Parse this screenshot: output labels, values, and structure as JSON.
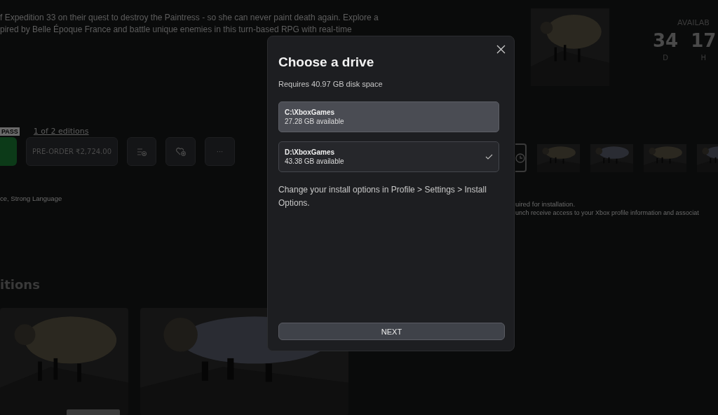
{
  "background": {
    "description": [
      "f Expedition 33 on their quest to destroy the Paintress - so she can never paint death again. Explore a",
      "pired by Belle Époque France and battle unique enemies in this turn-based RPG with real-time"
    ],
    "pass_badge": "PASS",
    "editions_link": "1 of 2 editions",
    "preorder_button": "PRE-ORDER ₹2,724.00",
    "more_button": "···",
    "rating_text": "ce, Strong Language",
    "editions_heading": "itions",
    "countdown": {
      "label": "AVAILAB",
      "units": [
        {
          "value": "34",
          "unit": "D"
        },
        {
          "value": "17",
          "unit": "H"
        }
      ]
    },
    "notes": [
      "uired for installation.",
      "unch receive access to your Xbox profile information and associat"
    ]
  },
  "dialog": {
    "title": "Choose a drive",
    "subtitle": "Requires 40.97 GB disk space",
    "drives": [
      {
        "path": "C:\\XboxGames",
        "space": "27.28 GB available",
        "selected": false,
        "focused": true
      },
      {
        "path": "D:\\XboxGames",
        "space": "43.38 GB available",
        "selected": true,
        "focused": false
      }
    ],
    "hint": "Change your install options in Profile > Settings > Install Options.",
    "next_button": "NEXT"
  }
}
